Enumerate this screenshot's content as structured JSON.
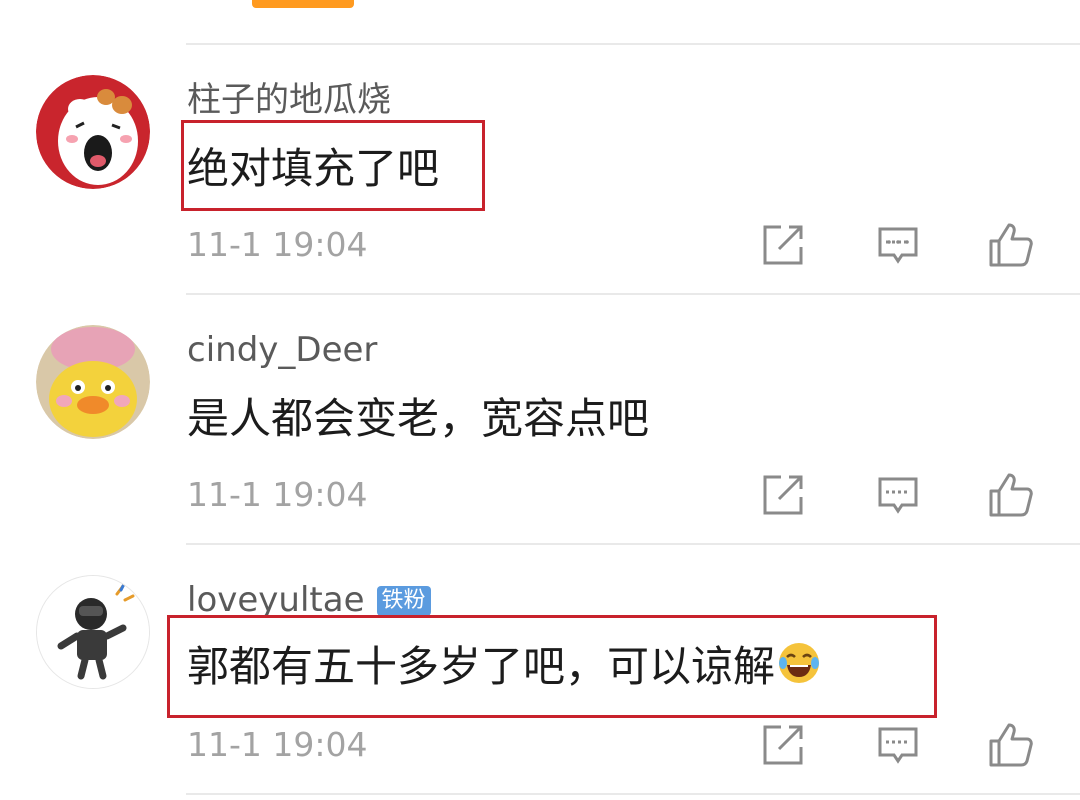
{
  "colors": {
    "accent_orange": "#ff9a1f",
    "highlight_red": "#c8222c",
    "badge_blue": "#5b9bdf",
    "timestamp_gray": "#a3a3a3",
    "username_gray": "#5a5a5a",
    "text_dark": "#1c1c1c"
  },
  "comments": [
    {
      "username": "柱子的地瓜烧",
      "text": "绝对填充了吧",
      "timestamp": "11-1 19:04",
      "avatar_icon": "cartoon-hamster-avatar",
      "highlighted": true
    },
    {
      "username": "cindy_Deer",
      "text": "是人都会变老，宽容点吧",
      "timestamp": "11-1 19:04",
      "avatar_icon": "yellow-duck-avatar",
      "highlighted": false
    },
    {
      "username": "loveyultae",
      "badge": "铁粉",
      "text": "郭都有五十多岁了吧，可以谅解",
      "emoji": "laughing-tears-emoji",
      "timestamp": "11-1 19:04",
      "avatar_icon": "astronaut-figure-avatar",
      "highlighted": true
    }
  ],
  "actions": {
    "share_icon": "share-icon",
    "reply_icon": "comment-icon",
    "like_icon": "thumbs-up-icon"
  }
}
